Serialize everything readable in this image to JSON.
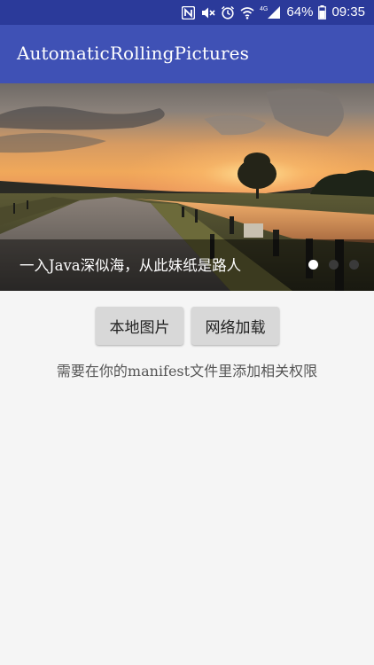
{
  "status_bar": {
    "battery_percent": "64%",
    "time": "09:35",
    "network_type": "4G",
    "icons": [
      "nfc-icon",
      "mute-icon",
      "alarm-icon",
      "wifi-icon",
      "signal-icon",
      "battery-icon"
    ]
  },
  "app_bar": {
    "title": "AutomaticRollingPictures",
    "color": "#3f51b5"
  },
  "banner": {
    "caption": "一入Java深似海，从此妹纸是路人",
    "indicator_count": 3,
    "active_index": 0
  },
  "buttons": {
    "local_label": "本地图片",
    "network_label": "网络加载"
  },
  "hint": {
    "text": "需要在你的manifest文件里添加相关权限"
  }
}
